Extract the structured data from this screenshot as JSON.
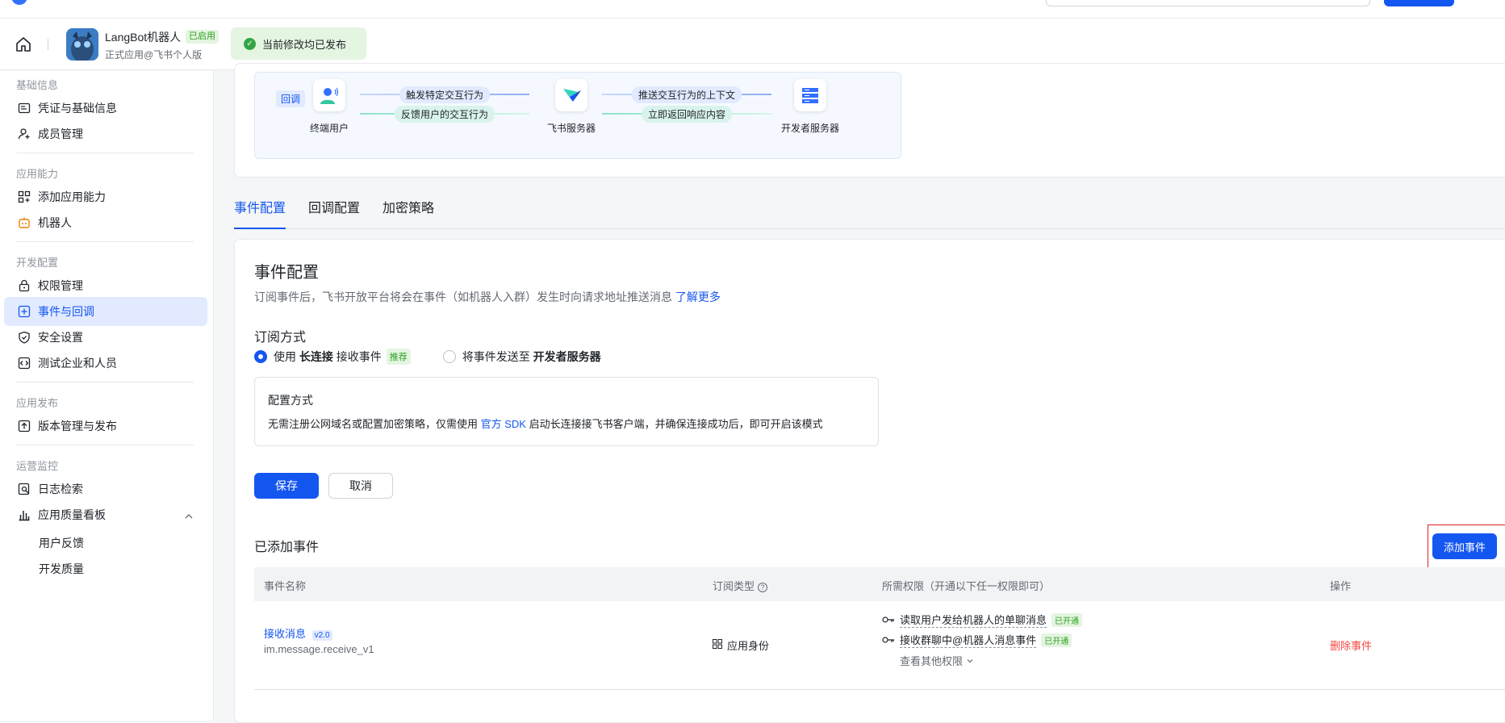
{
  "header": {
    "app_name": "LangBot机器人",
    "status_badge": "已启用",
    "app_subtitle": "正式应用@飞书个人版",
    "publish_status": "当前修改均已发布"
  },
  "sidebar": {
    "groups": [
      {
        "label": "基础信息"
      },
      {
        "label": "应用能力"
      },
      {
        "label": "开发配置"
      },
      {
        "label": "应用发布"
      },
      {
        "label": "运营监控"
      }
    ],
    "items": [
      {
        "label": "凭证与基础信息",
        "icon": "credential-icon"
      },
      {
        "label": "成员管理",
        "icon": "add-member-icon"
      },
      {
        "label": "添加应用能力",
        "icon": "apps-grid-icon"
      },
      {
        "label": "机器人",
        "icon": "robot-icon"
      },
      {
        "label": "权限管理",
        "icon": "lock-icon"
      },
      {
        "label": "事件与回调",
        "icon": "event-icon"
      },
      {
        "label": "安全设置",
        "icon": "shield-icon"
      },
      {
        "label": "测试企业和人员",
        "icon": "code-icon"
      },
      {
        "label": "版本管理与发布",
        "icon": "upload-icon"
      },
      {
        "label": "日志检索",
        "icon": "log-search-icon"
      },
      {
        "label": "应用质量看板",
        "icon": "bar-chart-icon"
      }
    ],
    "subitems": [
      {
        "label": "用户反馈"
      },
      {
        "label": "开发质量"
      }
    ]
  },
  "flow": {
    "callback_tag": "回调",
    "nodes": [
      {
        "label": "终端用户"
      },
      {
        "label": "飞书服务器"
      },
      {
        "label": "开发者服务器"
      }
    ],
    "arrows": [
      {
        "label": "触发特定交互行为"
      },
      {
        "label": "反馈用户的交互行为"
      },
      {
        "label": "推送交互行为的上下文"
      },
      {
        "label": "立即返回响应内容"
      }
    ]
  },
  "tabs": [
    {
      "label": "事件配置",
      "active": true
    },
    {
      "label": "回调配置",
      "active": false
    },
    {
      "label": "加密策略",
      "active": false
    }
  ],
  "event_config": {
    "title": "事件配置",
    "desc": "订阅事件后，飞书开放平台将会在事件（如机器人入群）发生时向请求地址推送消息",
    "learn_more": "了解更多",
    "subscribe_title": "订阅方式",
    "option1_prefix": "使用",
    "option1_bold": "长连接",
    "option1_suffix": "接收事件",
    "option1_tag": "推荐",
    "option2_prefix": "将事件发送至",
    "option2_bold": "开发者服务器",
    "config_title": "配置方式",
    "config_text_1": "无需注册公网域名或配置加密策略，仅需使用",
    "config_link": "官方 SDK",
    "config_text_2": "启动长连接接飞书客户端，并确保连接成功后，即可开启该模式",
    "save_label": "保存",
    "cancel_label": "取消"
  },
  "events": {
    "title": "已添加事件",
    "add_label": "添加事件",
    "columns": [
      "事件名称",
      "订阅类型",
      "所需权限（开通以下任一权限即可）",
      "操作"
    ],
    "rows": [
      {
        "name": "接收消息",
        "version": "v2.0",
        "code": "im.message.receive_v1",
        "sub_type": "应用身份",
        "permissions": [
          {
            "label": "读取用户发给机器人的单聊消息",
            "status": "已开通"
          },
          {
            "label": "接收群聊中@机器人消息事件",
            "status": "已开通"
          }
        ],
        "more_perms": "查看其他权限",
        "action": "删除事件"
      }
    ]
  },
  "colors": {
    "primary": "#1456f0",
    "danger": "#f54a45",
    "success": "#2ea121"
  }
}
